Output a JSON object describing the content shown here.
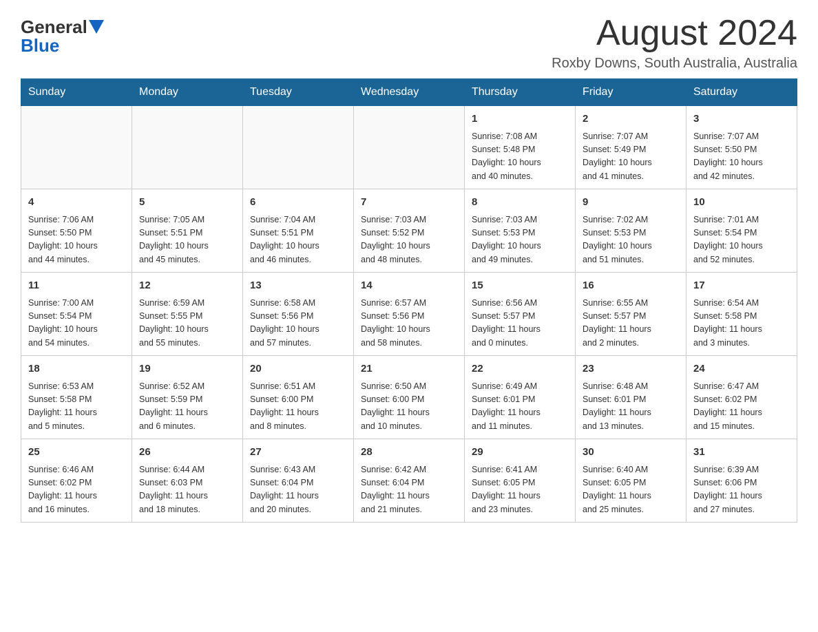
{
  "logo": {
    "text_general": "General",
    "text_blue": "Blue",
    "arrow_label": "logo-arrow"
  },
  "header": {
    "month_title": "August 2024",
    "location": "Roxby Downs, South Australia, Australia"
  },
  "columns": [
    "Sunday",
    "Monday",
    "Tuesday",
    "Wednesday",
    "Thursday",
    "Friday",
    "Saturday"
  ],
  "weeks": [
    [
      {
        "day": "",
        "info": ""
      },
      {
        "day": "",
        "info": ""
      },
      {
        "day": "",
        "info": ""
      },
      {
        "day": "",
        "info": ""
      },
      {
        "day": "1",
        "info": "Sunrise: 7:08 AM\nSunset: 5:48 PM\nDaylight: 10 hours\nand 40 minutes."
      },
      {
        "day": "2",
        "info": "Sunrise: 7:07 AM\nSunset: 5:49 PM\nDaylight: 10 hours\nand 41 minutes."
      },
      {
        "day": "3",
        "info": "Sunrise: 7:07 AM\nSunset: 5:50 PM\nDaylight: 10 hours\nand 42 minutes."
      }
    ],
    [
      {
        "day": "4",
        "info": "Sunrise: 7:06 AM\nSunset: 5:50 PM\nDaylight: 10 hours\nand 44 minutes."
      },
      {
        "day": "5",
        "info": "Sunrise: 7:05 AM\nSunset: 5:51 PM\nDaylight: 10 hours\nand 45 minutes."
      },
      {
        "day": "6",
        "info": "Sunrise: 7:04 AM\nSunset: 5:51 PM\nDaylight: 10 hours\nand 46 minutes."
      },
      {
        "day": "7",
        "info": "Sunrise: 7:03 AM\nSunset: 5:52 PM\nDaylight: 10 hours\nand 48 minutes."
      },
      {
        "day": "8",
        "info": "Sunrise: 7:03 AM\nSunset: 5:53 PM\nDaylight: 10 hours\nand 49 minutes."
      },
      {
        "day": "9",
        "info": "Sunrise: 7:02 AM\nSunset: 5:53 PM\nDaylight: 10 hours\nand 51 minutes."
      },
      {
        "day": "10",
        "info": "Sunrise: 7:01 AM\nSunset: 5:54 PM\nDaylight: 10 hours\nand 52 minutes."
      }
    ],
    [
      {
        "day": "11",
        "info": "Sunrise: 7:00 AM\nSunset: 5:54 PM\nDaylight: 10 hours\nand 54 minutes."
      },
      {
        "day": "12",
        "info": "Sunrise: 6:59 AM\nSunset: 5:55 PM\nDaylight: 10 hours\nand 55 minutes."
      },
      {
        "day": "13",
        "info": "Sunrise: 6:58 AM\nSunset: 5:56 PM\nDaylight: 10 hours\nand 57 minutes."
      },
      {
        "day": "14",
        "info": "Sunrise: 6:57 AM\nSunset: 5:56 PM\nDaylight: 10 hours\nand 58 minutes."
      },
      {
        "day": "15",
        "info": "Sunrise: 6:56 AM\nSunset: 5:57 PM\nDaylight: 11 hours\nand 0 minutes."
      },
      {
        "day": "16",
        "info": "Sunrise: 6:55 AM\nSunset: 5:57 PM\nDaylight: 11 hours\nand 2 minutes."
      },
      {
        "day": "17",
        "info": "Sunrise: 6:54 AM\nSunset: 5:58 PM\nDaylight: 11 hours\nand 3 minutes."
      }
    ],
    [
      {
        "day": "18",
        "info": "Sunrise: 6:53 AM\nSunset: 5:58 PM\nDaylight: 11 hours\nand 5 minutes."
      },
      {
        "day": "19",
        "info": "Sunrise: 6:52 AM\nSunset: 5:59 PM\nDaylight: 11 hours\nand 6 minutes."
      },
      {
        "day": "20",
        "info": "Sunrise: 6:51 AM\nSunset: 6:00 PM\nDaylight: 11 hours\nand 8 minutes."
      },
      {
        "day": "21",
        "info": "Sunrise: 6:50 AM\nSunset: 6:00 PM\nDaylight: 11 hours\nand 10 minutes."
      },
      {
        "day": "22",
        "info": "Sunrise: 6:49 AM\nSunset: 6:01 PM\nDaylight: 11 hours\nand 11 minutes."
      },
      {
        "day": "23",
        "info": "Sunrise: 6:48 AM\nSunset: 6:01 PM\nDaylight: 11 hours\nand 13 minutes."
      },
      {
        "day": "24",
        "info": "Sunrise: 6:47 AM\nSunset: 6:02 PM\nDaylight: 11 hours\nand 15 minutes."
      }
    ],
    [
      {
        "day": "25",
        "info": "Sunrise: 6:46 AM\nSunset: 6:02 PM\nDaylight: 11 hours\nand 16 minutes."
      },
      {
        "day": "26",
        "info": "Sunrise: 6:44 AM\nSunset: 6:03 PM\nDaylight: 11 hours\nand 18 minutes."
      },
      {
        "day": "27",
        "info": "Sunrise: 6:43 AM\nSunset: 6:04 PM\nDaylight: 11 hours\nand 20 minutes."
      },
      {
        "day": "28",
        "info": "Sunrise: 6:42 AM\nSunset: 6:04 PM\nDaylight: 11 hours\nand 21 minutes."
      },
      {
        "day": "29",
        "info": "Sunrise: 6:41 AM\nSunset: 6:05 PM\nDaylight: 11 hours\nand 23 minutes."
      },
      {
        "day": "30",
        "info": "Sunrise: 6:40 AM\nSunset: 6:05 PM\nDaylight: 11 hours\nand 25 minutes."
      },
      {
        "day": "31",
        "info": "Sunrise: 6:39 AM\nSunset: 6:06 PM\nDaylight: 11 hours\nand 27 minutes."
      }
    ]
  ]
}
